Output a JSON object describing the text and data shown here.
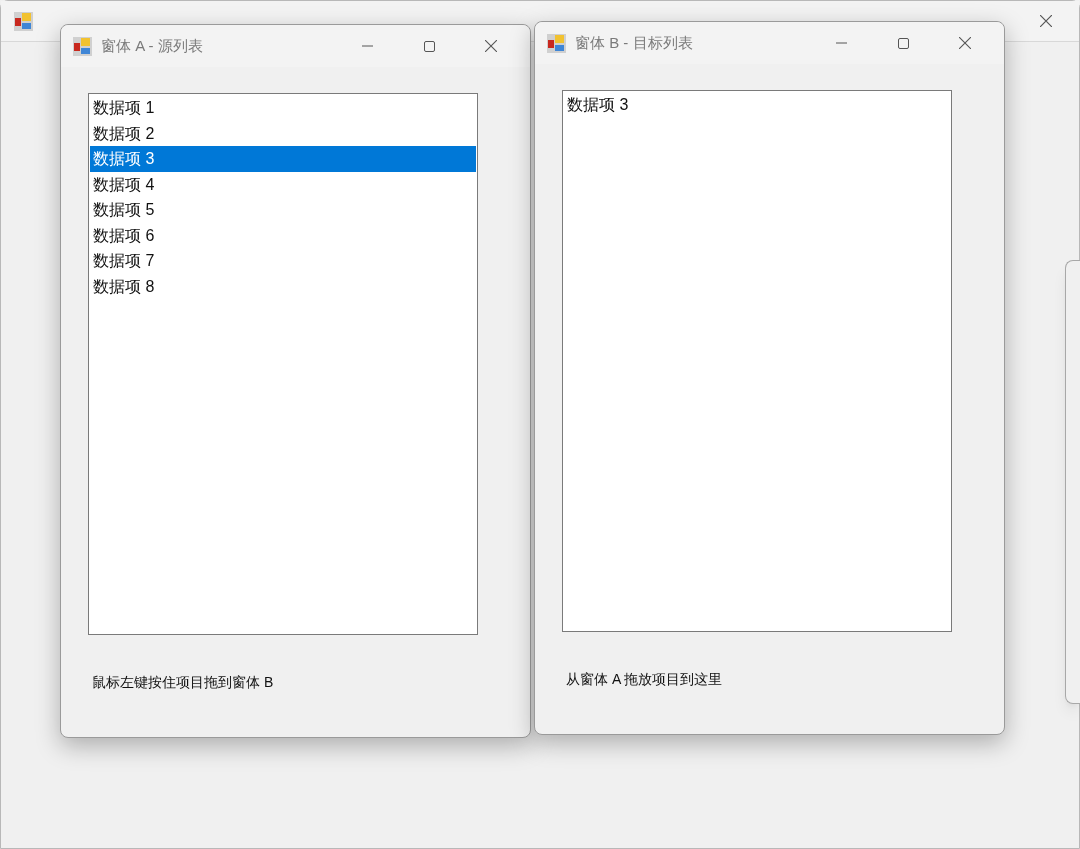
{
  "windows": [
    {
      "title": "窗体 A - 源列表",
      "items": [
        {
          "text": "数据项 1",
          "selected": false
        },
        {
          "text": "数据项 2",
          "selected": false
        },
        {
          "text": "数据项 3",
          "selected": true
        },
        {
          "text": "数据项 4",
          "selected": false
        },
        {
          "text": "数据项 5",
          "selected": false
        },
        {
          "text": "数据项 6",
          "selected": false
        },
        {
          "text": "数据项 7",
          "selected": false
        },
        {
          "text": "数据项 8",
          "selected": false
        }
      ],
      "hint": "鼠标左键按住项目拖到窗体 B"
    },
    {
      "title": "窗体 B - 目标列表",
      "items": [
        {
          "text": "数据项 3",
          "selected": false
        }
      ],
      "hint": "从窗体 A 拖放项目到这里"
    }
  ]
}
